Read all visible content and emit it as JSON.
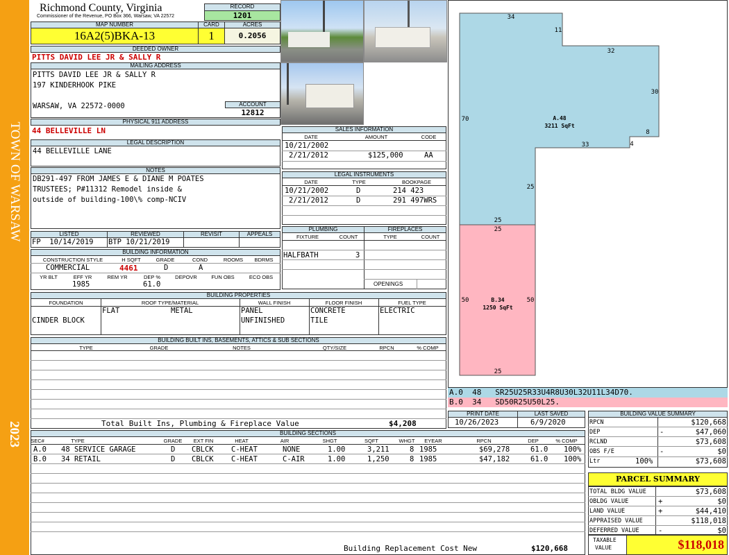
{
  "side": {
    "town": "TOWN OF WARSAW",
    "year": "2023"
  },
  "header": {
    "county": "Richmond County, Virginia",
    "commissioner": "Commissioner of the Revenue, PO Box 366, Warsaw, VA 22572",
    "record_label": "RECORD",
    "record": "1201",
    "map_label": "MAP NUMBER",
    "map": "16A2(5)BKA-13",
    "card_label": "CARD",
    "card": "1",
    "acres_label": "ACRES",
    "acres": "0.2056"
  },
  "owner": {
    "label": "DEEDED OWNER",
    "name": "PITTS DAVID LEE JR & SALLY R",
    "mail_label": "MAILING ADDRESS",
    "mail1": "PITTS DAVID LEE JR & SALLY R",
    "mail2": "197 KINDERHOOK PIKE",
    "mail3": "WARSAW, VA 22572-0000",
    "account_label": "ACCOUNT",
    "account": "12812"
  },
  "address": {
    "label": "PHYSICAL 911 ADDRESS",
    "value": "44 BELLEVILLE LN"
  },
  "legal": {
    "label": "LEGAL DESCRIPTION",
    "value": "44 BELLEVILLE LANE"
  },
  "notes": {
    "label": "NOTES",
    "l1": "DB291-497 FROM JAMES E & DIANE M POATES",
    "l2": "TRUSTEES; P#11312 Remodel inside &",
    "l3": "outside of building-100\\% comp-NCIV"
  },
  "sales": {
    "label": "SALES INFORMATION",
    "h": [
      "DATE",
      "AMOUNT",
      "CODE"
    ],
    "rows": [
      [
        "10/21/2002",
        "",
        ""
      ],
      [
        "2/21/2012",
        "$125,000",
        "AA"
      ]
    ]
  },
  "legal_inst": {
    "label": "LEGAL INSTRUMENTS",
    "h": [
      "DATE",
      "TYPE",
      "BOOKPAGE"
    ],
    "rows": [
      [
        "10/21/2002",
        "D",
        "214 423"
      ],
      [
        "2/21/2012",
        "D",
        "291 497WRS"
      ]
    ]
  },
  "review": {
    "h": [
      "LISTED",
      "REVIEWED",
      "REVISIT",
      "APPEALS"
    ],
    "listed": "FP  10/14/2019",
    "reviewed": "BTP 10/21/2019"
  },
  "building": {
    "label": "BUILDING INFORMATION",
    "h": [
      "CONSTRUCTION STYLE",
      "H SQFT",
      "GRADE",
      "COND",
      "ROOMS",
      "BDRMS"
    ],
    "style": "COMMERCIAL",
    "hsqft": "4461",
    "grade": "D",
    "cond": "A",
    "h2": [
      "YR BLT",
      "EFF YR",
      "REM YR",
      "DEP %",
      "DEPOVR",
      "FUN OBS",
      "ECO OBS"
    ],
    "effyr": "1985",
    "dep": "61.0"
  },
  "plumbing": {
    "label": "PLUMBING",
    "h": [
      "FIXTURE",
      "COUNT"
    ],
    "fixture": "HALFBATH",
    "count": "3"
  },
  "fireplaces": {
    "label": "FIREPLACES",
    "h": [
      "TYPE",
      "COUNT"
    ],
    "openings": "OPENINGS"
  },
  "props": {
    "label": "BUILDING PROPERTIES",
    "h": [
      "FOUNDATION",
      "ROOF TYPE/MATERIAL",
      "WALL FINISH",
      "FLOOR FINISH",
      "FUEL TYPE"
    ],
    "foundation": "CINDER BLOCK",
    "roof1": "FLAT",
    "roof2": "METAL",
    "wall1": "PANEL",
    "wall2": "UNFINISHED",
    "floor1": "CONCRETE",
    "floor2": "TILE",
    "fuel": "ELECTRIC"
  },
  "builtins": {
    "label": "BUILDING BUILT INS, BASEMENTS, ATTICS & SUB SECTIONS",
    "h": [
      "TYPE",
      "GRADE",
      "NOTES",
      "QTY/SIZE",
      "RPCN",
      "% COMP"
    ],
    "total_label": "Total Built Ins, Plumbing & Fireplace Value",
    "total": "$4,208"
  },
  "sections": {
    "label": "BUILDING SECTIONS",
    "h": [
      "SEC#",
      "TYPE",
      "GRADE",
      "EXT FIN",
      "HEAT",
      "AIR",
      "SHGT",
      "SQFT",
      "WHGT",
      "EYEAR",
      "RPCN",
      "DEP",
      "% COMP"
    ],
    "rows": [
      [
        "A.0",
        "48 SERVICE GARAGE",
        "D",
        "CBLCK",
        "C-HEAT",
        "NONE",
        "1.00",
        "3,211",
        "8",
        "1985",
        "$69,278",
        "61.0",
        "100%"
      ],
      [
        "B.0",
        "34 RETAIL",
        "D",
        "CBLCK",
        "C-HEAT",
        "C-AIR",
        "1.00",
        "1,250",
        "8",
        "1985",
        "$47,182",
        "61.0",
        "100%"
      ]
    ],
    "brcn_label": "Building Replacement Cost New",
    "brcn": "$120,668"
  },
  "sketch": {
    "a_label": "A.48",
    "a_area": "3211 SqFt",
    "b_label": "B.34",
    "b_area": "1250 SqFt",
    "dims": {
      "a_top": "34",
      "a_11": "11",
      "a_32": "32",
      "a_30": "30",
      "a_8": "8",
      "a_4": "4",
      "a_33": "33",
      "a_70": "70",
      "a_25r": "25",
      "a_25b": "25",
      "b_25t": "25",
      "b_50l": "50",
      "b_50r": "50",
      "b_25b": "25"
    },
    "colors": {
      "a": "#add8e6",
      "b": "#ffb6c1"
    },
    "code_a": "A.0  48   SR25U25R33U4R8U30L32U11L34D70.",
    "code_b": "B.0  34   SD50R25U50L25."
  },
  "dates": {
    "print_label": "PRINT DATE",
    "print": "10/26/2023",
    "saved_label": "LAST SAVED",
    "saved": "6/9/2020"
  },
  "summary": {
    "label": "BUILDING VALUE SUMMARY",
    "rpcn_l": "RPCN",
    "rpcn": "$120,668",
    "dep_l": "DEP",
    "dep_s": "-",
    "dep": "$47,060",
    "rclnd_l": "RCLND",
    "rclnd": "$73,608",
    "obs_l": "OBS F/E",
    "obs_s": "-",
    "obs": "$0",
    "ltr_l": "Ltr",
    "ltr_p": "100%",
    "ltr": "$73,608"
  },
  "parcel": {
    "label": "PARCEL SUMMARY",
    "bldg_l": "TOTAL BLDG VALUE",
    "bldg": "$73,608",
    "obldg_l": "OBLDG VALUE",
    "obldg_s": "+",
    "obldg": "$0",
    "land_l": "LAND VALUE",
    "land_s": "+",
    "land": "$44,410",
    "appr_l": "APPRAISED VALUE",
    "appr": "$118,018",
    "def_l": "DEFERRED VALUE",
    "def_s": "-",
    "def": "$0",
    "tax_l1": "TAXABLE",
    "tax_l2": "VALUE",
    "tax": "$118,018"
  }
}
